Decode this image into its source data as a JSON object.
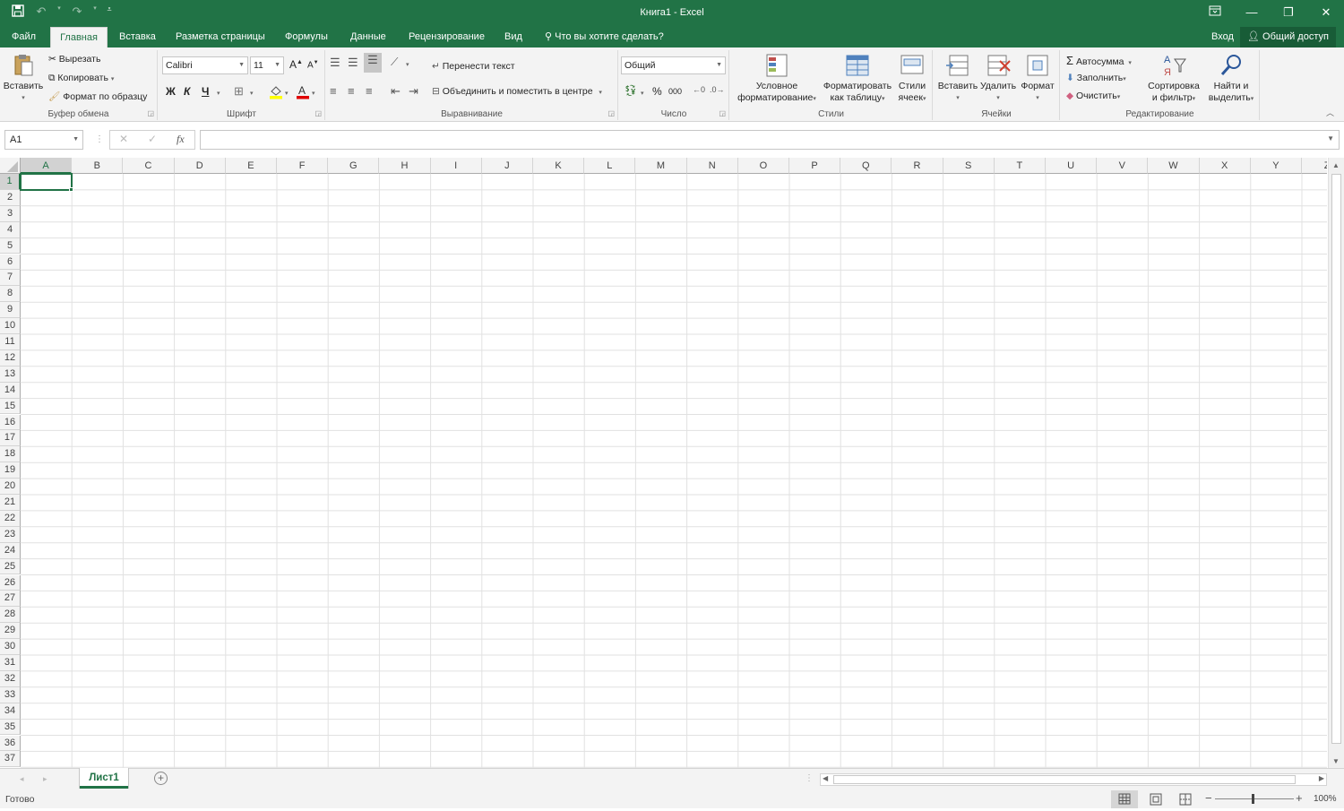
{
  "title": "Книга1 - Excel",
  "colors": {
    "accent": "#217346",
    "ribbon_bg": "#f3f3f3"
  },
  "qat": {
    "save_icon": "save-icon",
    "undo_icon": "undo-icon",
    "redo_icon": "redo-icon",
    "customize_icon": "customize-qat-icon"
  },
  "tabs": {
    "file": "Файл",
    "home": "Главная",
    "insert": "Вставка",
    "layout": "Разметка страницы",
    "formulas": "Формулы",
    "data": "Данные",
    "review": "Рецензирование",
    "view": "Вид",
    "tell": "Что вы хотите сделать?",
    "signin": "Вход",
    "share": "Общий доступ"
  },
  "clipboard": {
    "paste": "Вставить",
    "cut": "Вырезать",
    "copy": "Копировать",
    "format_painter": "Формат по образцу",
    "label": "Буфер обмена"
  },
  "font": {
    "name": "Calibri",
    "size": "11",
    "bold": "Ж",
    "italic": "К",
    "underline": "Ч",
    "grow": "A",
    "shrink": "A",
    "label": "Шрифт"
  },
  "alignment": {
    "wrap": "Перенести текст",
    "merge": "Объединить и поместить в центре",
    "label": "Выравнивание"
  },
  "number": {
    "format": "Общий",
    "percent": "%",
    "thousands": "000",
    "label": "Число"
  },
  "styles": {
    "conditional": [
      "Условное",
      "форматирование"
    ],
    "table": [
      "Форматировать",
      "как таблицу"
    ],
    "cell": [
      "Стили",
      "ячеек"
    ],
    "label": "Стили"
  },
  "cells": {
    "insert": "Вставить",
    "delete": "Удалить",
    "format": "Формат",
    "label": "Ячейки"
  },
  "editing": {
    "autosum": "Автосумма",
    "fill": "Заполнить",
    "clear": "Очистить",
    "sort": [
      "Сортировка",
      "и фильтр"
    ],
    "find": [
      "Найти и",
      "выделить"
    ],
    "label": "Редактирование"
  },
  "formula_bar": {
    "name_box": "A1",
    "fx": "fx",
    "value": ""
  },
  "grid": {
    "columns": [
      "A",
      "B",
      "C",
      "D",
      "E",
      "F",
      "G",
      "H",
      "I",
      "J",
      "K",
      "L",
      "M",
      "N",
      "O",
      "P",
      "Q",
      "R",
      "S",
      "T",
      "U",
      "V",
      "W",
      "X",
      "Y",
      "Z"
    ],
    "rows": [
      "1",
      "2",
      "3",
      "4",
      "5",
      "6",
      "7",
      "8",
      "9",
      "10",
      "11",
      "12",
      "13",
      "14",
      "15",
      "16",
      "17",
      "18",
      "19",
      "20",
      "21",
      "22",
      "23",
      "24",
      "25",
      "26",
      "27",
      "28",
      "29",
      "30",
      "31",
      "32",
      "33",
      "34",
      "35",
      "36",
      "37"
    ],
    "selected": "A1"
  },
  "sheets": [
    "Лист1"
  ],
  "status": {
    "ready": "Готово",
    "zoom": "100%"
  }
}
